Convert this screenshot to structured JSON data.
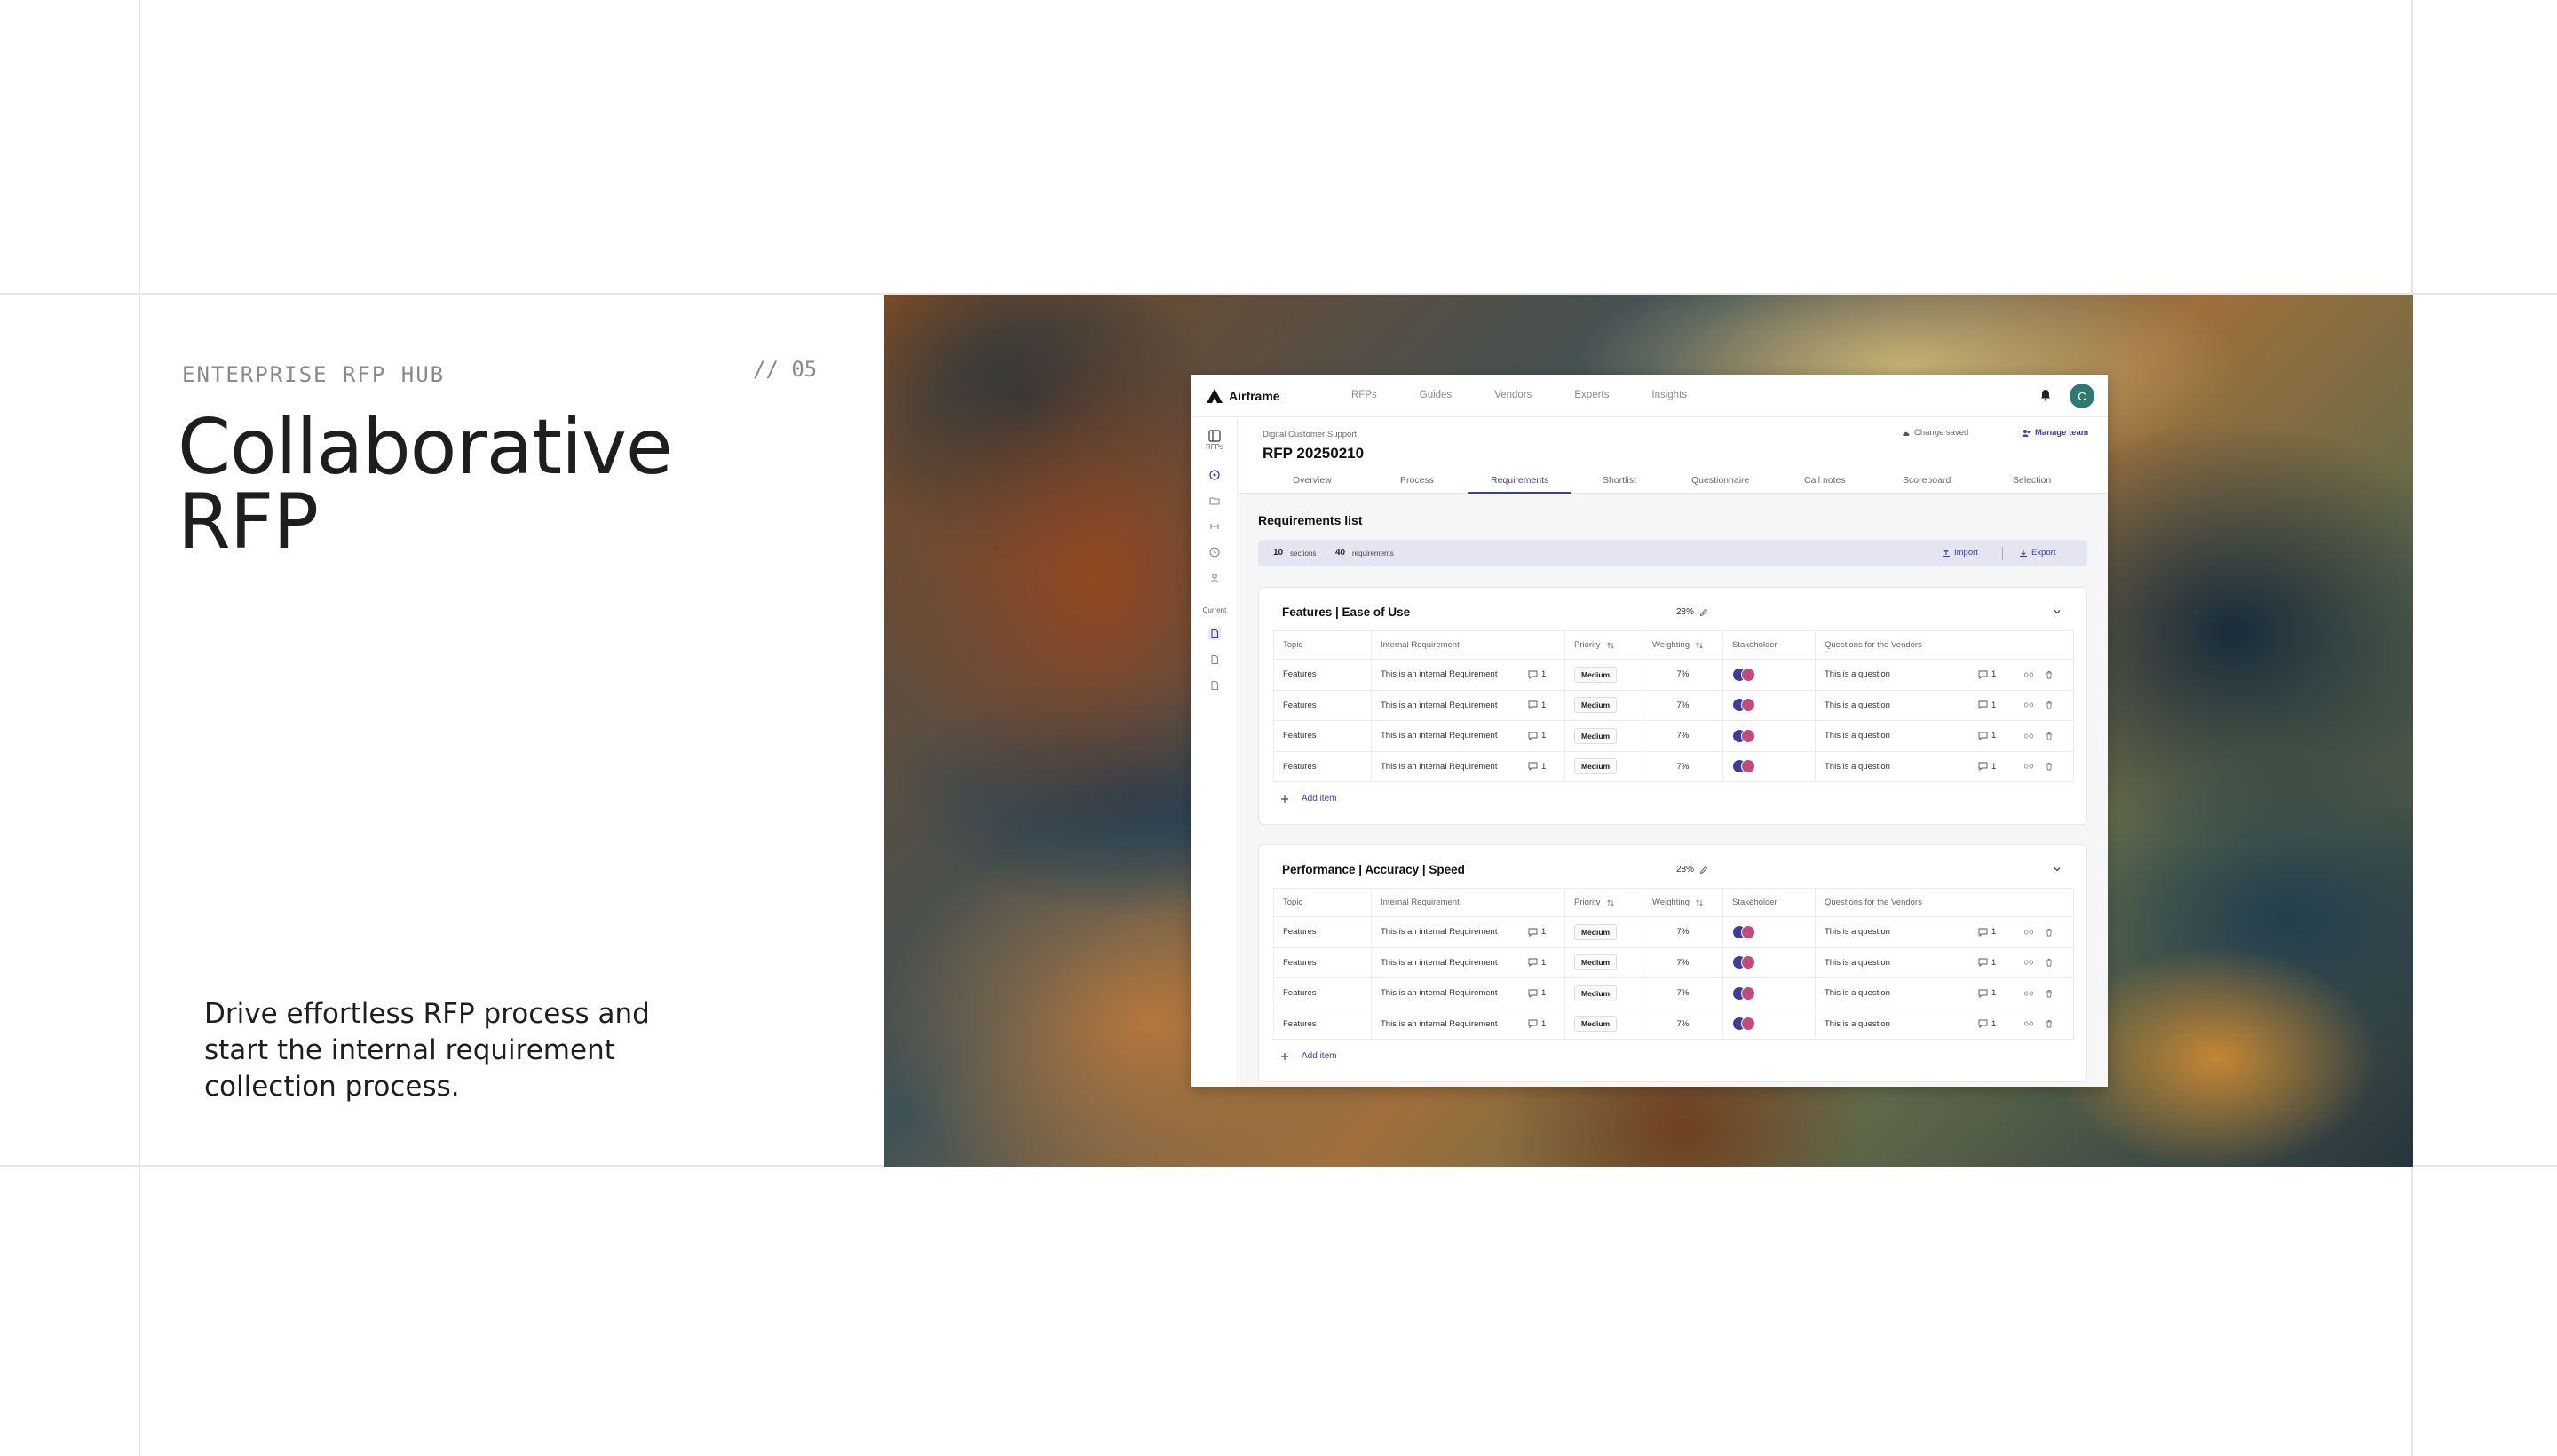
{
  "slide": {
    "eyebrow": "ENTERPRISE RFP HUB",
    "number": "// 05",
    "headline_line1": "Collaborative",
    "headline_line2": "RFP",
    "description": "Drive effortless RFP process and start the internal requirement collection process."
  },
  "app": {
    "brand": "Airframe",
    "nav": [
      "RFPs",
      "Guides",
      "Vendors",
      "Experts",
      "Insights"
    ],
    "avatar_initial": "C",
    "sidebar": {
      "rfps_label": "RFPs",
      "current_label": "Current"
    },
    "breadcrumb": "Digital Customer Support",
    "title": "RFP 20250210",
    "status": "Change saved",
    "manage_team": "Manage team",
    "tabs": [
      "Overview",
      "Process",
      "Requirements",
      "Shortlist",
      "Questionnaire",
      "Call notes",
      "Scoreboard",
      "Selection"
    ],
    "active_tab": "Requirements",
    "requirements_title": "Requirements list",
    "stats": {
      "sections": "10",
      "sections_label": "sections",
      "requirements": "40",
      "requirements_label": "requirements"
    },
    "import_label": "Import",
    "export_label": "Export",
    "columns": [
      "Topic",
      "Internal Requirement",
      "Priority",
      "Weighting",
      "Stakeholder",
      "Questions for the Vendors"
    ],
    "sections": [
      {
        "title": "Features | Ease of Use",
        "percent": "28%",
        "rows": [
          {
            "topic": "Features",
            "requirement": "This is an internal Requirement",
            "req_comments": "1",
            "priority": "Medium",
            "weighting": "7%",
            "question": "This is a question",
            "q_comments": "1"
          },
          {
            "topic": "Features",
            "requirement": "This is an internal Requirement",
            "req_comments": "1",
            "priority": "Medium",
            "weighting": "7%",
            "question": "This is a question",
            "q_comments": "1"
          },
          {
            "topic": "Features",
            "requirement": "This is an internal Requirement",
            "req_comments": "1",
            "priority": "Medium",
            "weighting": "7%",
            "question": "This is a question",
            "q_comments": "1"
          },
          {
            "topic": "Features",
            "requirement": "This is an internal Requirement",
            "req_comments": "1",
            "priority": "Medium",
            "weighting": "7%",
            "question": "This is a question",
            "q_comments": "1"
          }
        ],
        "add_item": "Add item"
      },
      {
        "title": "Performance | Accuracy | Speed",
        "percent": "28%",
        "rows": [
          {
            "topic": "Features",
            "requirement": "This is an internal Requirement",
            "req_comments": "1",
            "priority": "Medium",
            "weighting": "7%",
            "question": "This is a question",
            "q_comments": "1"
          },
          {
            "topic": "Features",
            "requirement": "This is an internal Requirement",
            "req_comments": "1",
            "priority": "Medium",
            "weighting": "7%",
            "question": "This is a question",
            "q_comments": "1"
          },
          {
            "topic": "Features",
            "requirement": "This is an internal Requirement",
            "req_comments": "1",
            "priority": "Medium",
            "weighting": "7%",
            "question": "This is a question",
            "q_comments": "1"
          },
          {
            "topic": "Features",
            "requirement": "This is an internal Requirement",
            "req_comments": "1",
            "priority": "Medium",
            "weighting": "7%",
            "question": "This is a question",
            "q_comments": "1"
          }
        ],
        "add_item": "Add item"
      }
    ]
  },
  "colors": {
    "accent": "#3a3f9a",
    "avatar": "#2d7a73"
  }
}
